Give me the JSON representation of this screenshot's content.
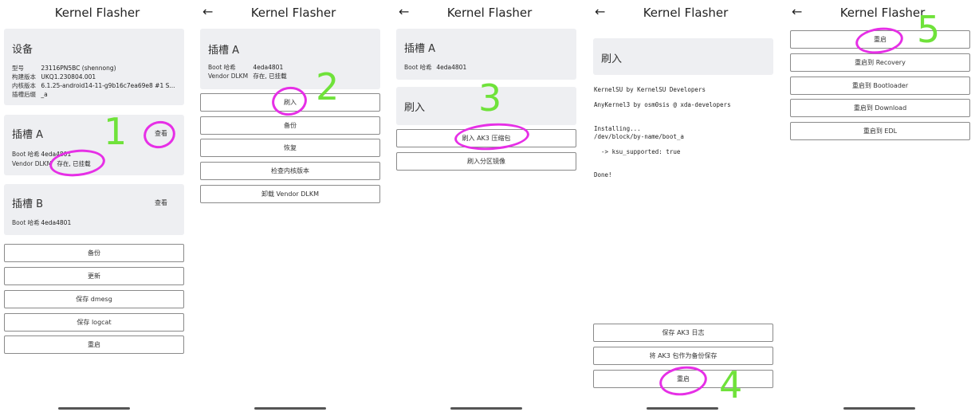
{
  "app_title": "Kernel Flasher",
  "panel1": {
    "device_card": {
      "title": "设备",
      "rows": [
        {
          "key": "型号",
          "value": "23116PN5BC (shennong)"
        },
        {
          "key": "构建版本",
          "value": "UKQ1.230804.001"
        },
        {
          "key": "内核版本",
          "value": "6.1.25-android14-11-g9b16c7ea69e8 #1 S..."
        },
        {
          "key": "插槽后缀",
          "value": "_a"
        }
      ]
    },
    "slot_a": {
      "title": "插槽 A",
      "view": "查看",
      "boot_key": "Boot 哈希",
      "boot_value": "4eda4801",
      "dlkm_key": "Vendor DLKM",
      "dlkm_value": "存在, 已挂载"
    },
    "slot_b": {
      "title": "插槽 B",
      "view": "查看",
      "boot_key": "Boot 哈希",
      "boot_value": "4eda4801"
    },
    "buttons": [
      "备份",
      "更新",
      "保存 dmesg",
      "保存 logcat",
      "重启"
    ]
  },
  "panel2": {
    "slot_a": {
      "title": "插槽 A",
      "boot_key": "Boot 哈希",
      "boot_value": "4eda4801",
      "dlkm_key": "Vendor DLKM",
      "dlkm_value": "存在, 已挂载"
    },
    "buttons": [
      "刷入",
      "备份",
      "恢复",
      "检查内核版本",
      "卸载 Vendor DLKM"
    ]
  },
  "panel3": {
    "slot_a": {
      "title": "插槽 A",
      "boot_key": "Boot 哈希",
      "boot_value": "4eda4801"
    },
    "flash_card": {
      "title": "刷入"
    },
    "buttons": [
      "刷入 AK3 压缩包",
      "刷入分区镜像"
    ]
  },
  "panel4": {
    "card_title": "刷入",
    "log_lines": [
      "KernelSU by KernelSU Developers",
      "AnyKernel3 by osm0sis @ xda-developers",
      "Installing...",
      "/dev/block/by-name/boot_a",
      "  -> ksu_supported: true",
      "Done!"
    ],
    "buttons": [
      "保存 AK3 日志",
      "将 AK3 包作为备份保存",
      "重启"
    ]
  },
  "panel5": {
    "buttons": [
      "重启",
      "重启到 Recovery",
      "重启到 Bootloader",
      "重启到 Download",
      "重启到 EDL"
    ]
  },
  "annotations": {
    "numbers": [
      "1",
      "2",
      "3",
      "4",
      "5"
    ],
    "circle_color": "#e62fe6",
    "number_color": "#6fe23a"
  }
}
